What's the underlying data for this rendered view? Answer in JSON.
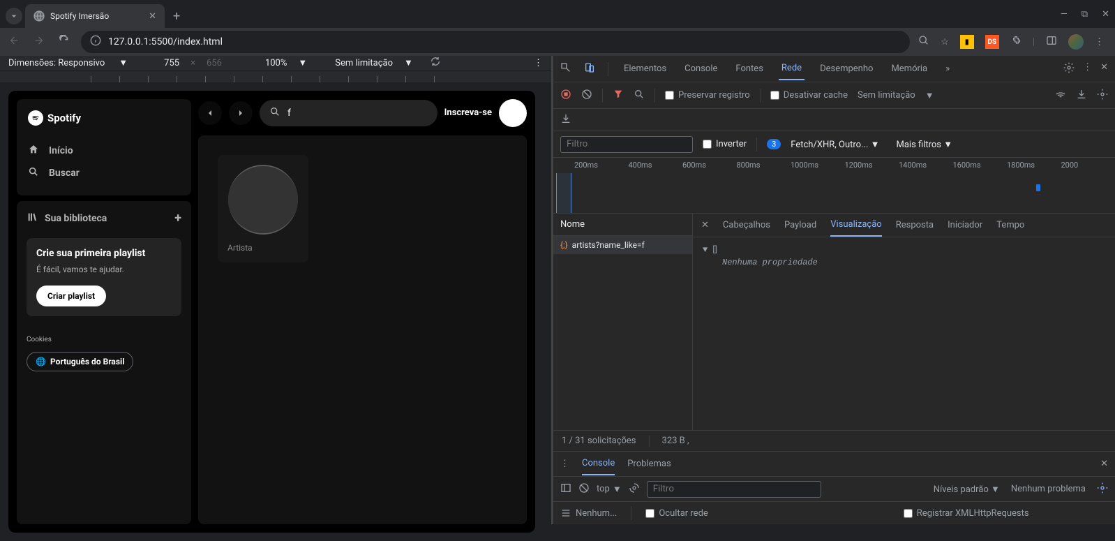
{
  "browser": {
    "tab_title": "Spotify Imersão",
    "url": "127.0.0.1:5500/index.html"
  },
  "device_bar": {
    "dimensions_label": "Dimensões: Responsivo",
    "width": "755",
    "height": "656",
    "zoom": "100%",
    "throttle": "Sem limitação"
  },
  "spotify": {
    "logo": "Spotify",
    "nav_home": "Início",
    "nav_search": "Buscar",
    "library": "Sua biblioteca",
    "card_title": "Crie sua primeira playlist",
    "card_sub": "É fácil, vamos te ajudar.",
    "card_btn": "Criar playlist",
    "cookies": "Cookies",
    "language": "Português do Brasil",
    "search_value": "f",
    "signup": "Inscreva-se",
    "artist_label": "Artista"
  },
  "devtools": {
    "tabs": [
      "Elementos",
      "Console",
      "Fontes",
      "Rede",
      "Desempenho",
      "Memória"
    ],
    "preserve_log": "Preservar registro",
    "disable_cache": "Desativar cache",
    "no_throttling": "Sem limitação",
    "filter_placeholder": "Filtro",
    "invert": "Inverter",
    "fetch_filter": "Fetch/XHR, Outro...",
    "fetch_badge": "3",
    "more_filters": "Mais filtros",
    "timeline_ticks": [
      "200ms",
      "400ms",
      "600ms",
      "800ms",
      "1000ms",
      "1200ms",
      "1400ms",
      "1600ms",
      "1800ms",
      "2000"
    ],
    "req_name_header": "Nome",
    "request": "artists?name_like=f",
    "req_tabs": [
      "Cabeçalhos",
      "Payload",
      "Visualização",
      "Resposta",
      "Iniciador",
      "Tempo"
    ],
    "empty_array": "[]",
    "no_property": "Nenhuma propriedade",
    "status": "1 / 31 solicitações",
    "size": "323 B ,",
    "drawer_console": "Console",
    "drawer_problems": "Problemas",
    "top": "top",
    "levels": "Níveis padrão",
    "no_problems": "Nenhum problema",
    "nenhum": "Nenhum...",
    "hide_network": "Ocultar rede",
    "log_xhr": "Registrar XMLHttpRequests"
  }
}
